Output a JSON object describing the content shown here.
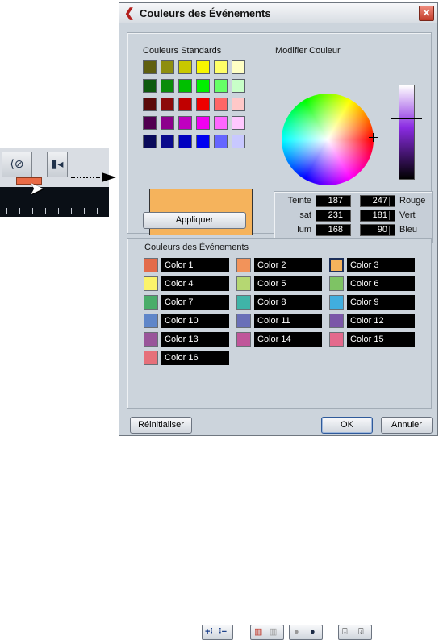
{
  "dialog": {
    "title": "Couleurs des Événements",
    "standard_colors_label": "Couleurs Standards",
    "modify_color_label": "Modifier Couleur",
    "apply_label": "Appliquer",
    "event_colors_label": "Couleurs des Événements",
    "reset_label": "Réinitialiser",
    "ok_label": "OK",
    "cancel_label": "Annuler",
    "preview_color": "#f5b35c"
  },
  "color_values": {
    "hue_label": "Teinte",
    "hue": "187",
    "sat_label": "sat",
    "sat": "231",
    "lum_label": "lum",
    "lum": "168",
    "red_label": "Rouge",
    "red": "247",
    "green_label": "Vert",
    "green": "181",
    "blue_label": "Bleu",
    "blue": "90"
  },
  "standard_colors": [
    [
      "#5f5f0f",
      "#8e8e10",
      "#c8c800",
      "#f6f600",
      "#ffff66",
      "#ffffc4"
    ],
    [
      "#0e5a0e",
      "#0a8c0a",
      "#00bf00",
      "#00f000",
      "#66ff66",
      "#c8ffc8"
    ],
    [
      "#5a0a0a",
      "#8c0a0a",
      "#c00000",
      "#f00000",
      "#ff6666",
      "#ffc8c8"
    ],
    [
      "#500050",
      "#8c008c",
      "#c000c0",
      "#f000f0",
      "#ff66ff",
      "#ffc8ff"
    ],
    [
      "#0a0a5a",
      "#0a0a8c",
      "#0000c0",
      "#0000f0",
      "#6666ff",
      "#c8c8ff"
    ]
  ],
  "event_colors": [
    {
      "name": "Color 1",
      "color": "#e36b4a"
    },
    {
      "name": "Color 2",
      "color": "#f2935a"
    },
    {
      "name": "Color 3",
      "color": "#f5b35c",
      "selected": true
    },
    {
      "name": "Color 4",
      "color": "#fbf36a"
    },
    {
      "name": "Color 5",
      "color": "#b5d772"
    },
    {
      "name": "Color 6",
      "color": "#7ec364"
    },
    {
      "name": "Color 7",
      "color": "#4aad6a"
    },
    {
      "name": "Color 8",
      "color": "#3fb4a8"
    },
    {
      "name": "Color 9",
      "color": "#41aedf"
    },
    {
      "name": "Color 10",
      "color": "#5f86c9"
    },
    {
      "name": "Color 11",
      "color": "#6a6fb8"
    },
    {
      "name": "Color 12",
      "color": "#7b56a8"
    },
    {
      "name": "Color 13",
      "color": "#99559a"
    },
    {
      "name": "Color 14",
      "color": "#c0569a"
    },
    {
      "name": "Color 15",
      "color": "#e4698c"
    },
    {
      "name": "Color 16",
      "color": "#e6707a"
    }
  ]
}
